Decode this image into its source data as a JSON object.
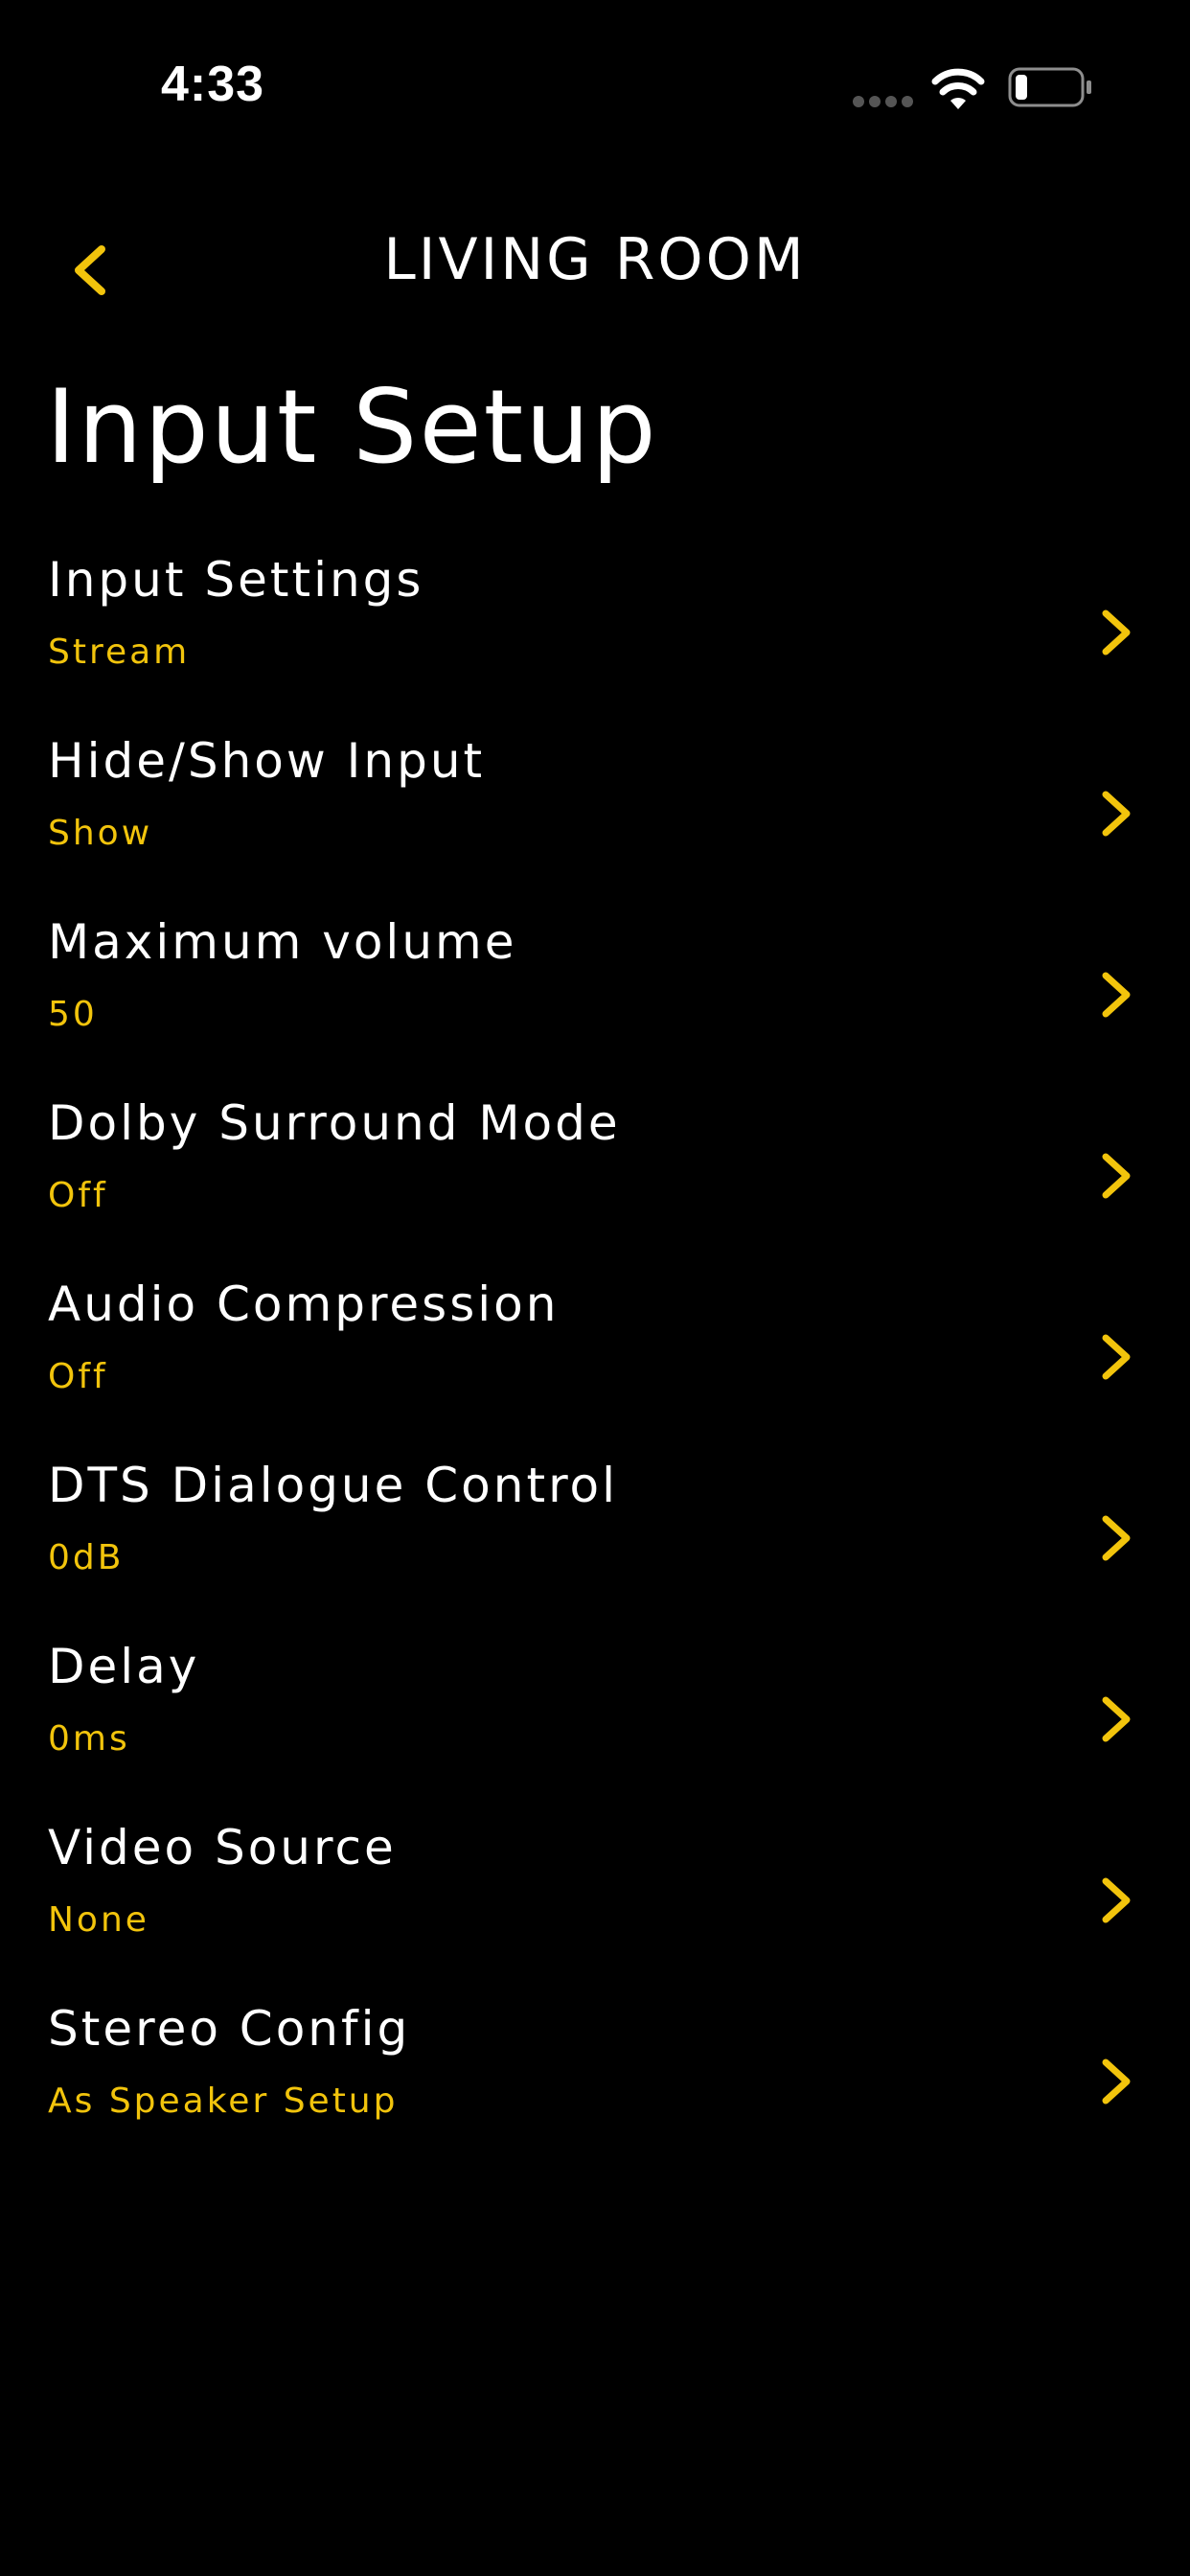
{
  "status_bar": {
    "time": "4:33",
    "signal_icon": "signal-dots-icon",
    "wifi_icon": "wifi-icon",
    "battery_icon": "battery-icon"
  },
  "nav": {
    "back_icon": "chevron-left-icon",
    "title": "LIVING ROOM"
  },
  "page": {
    "title": "Input Setup"
  },
  "settings": [
    {
      "label": "Input Settings",
      "value": "Stream"
    },
    {
      "label": "Hide/Show Input",
      "value": "Show"
    },
    {
      "label": "Maximum volume",
      "value": "50"
    },
    {
      "label": "Dolby Surround Mode",
      "value": "Off"
    },
    {
      "label": "Audio Compression",
      "value": "Off"
    },
    {
      "label": "DTS Dialogue Control",
      "value": "0dB"
    },
    {
      "label": "Delay",
      "value": "0ms"
    },
    {
      "label": "Video Source",
      "value": "None"
    },
    {
      "label": "Stereo Config",
      "value": "As Speaker Setup"
    }
  ],
  "colors": {
    "background": "#000000",
    "text": "#ffffff",
    "accent": "#f2c40c"
  }
}
